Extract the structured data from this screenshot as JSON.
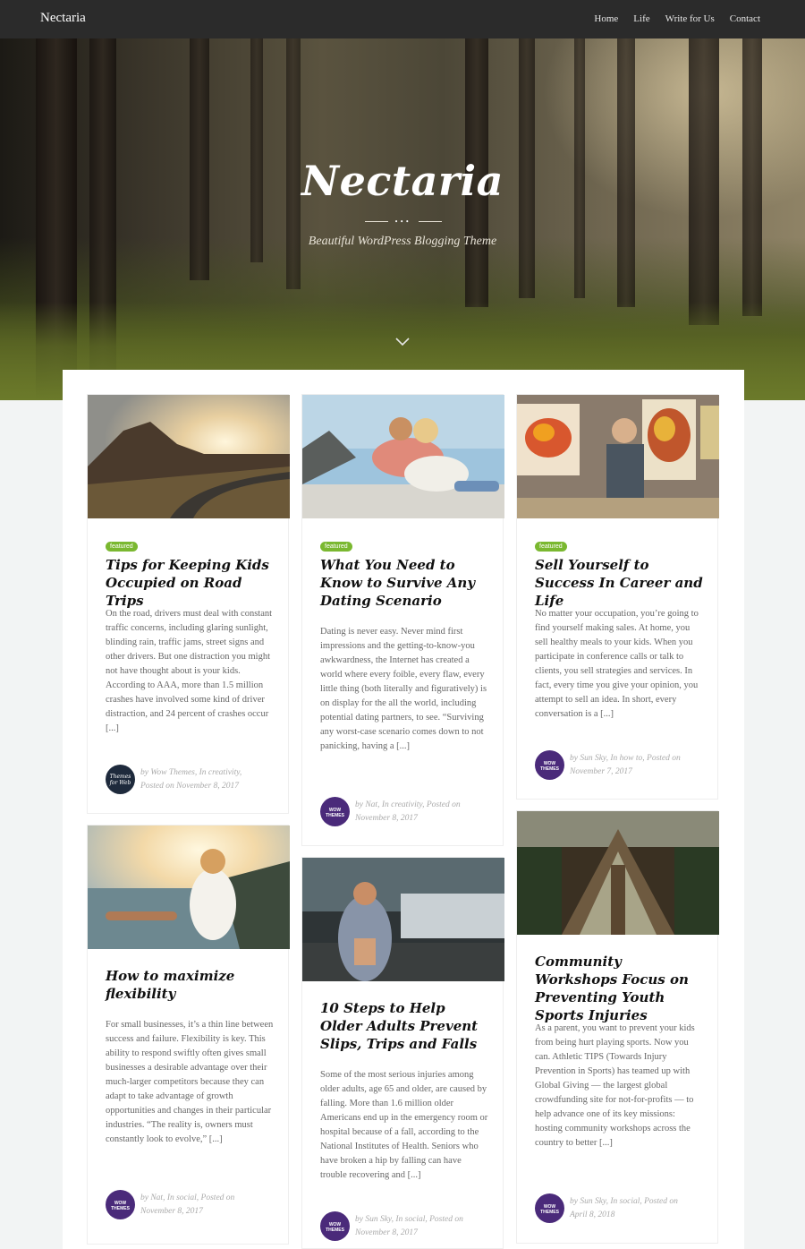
{
  "site": {
    "brand": "Nectaria",
    "nav": [
      "Home",
      "Life",
      "Write for Us",
      "Contact"
    ]
  },
  "hero": {
    "title": "Nectaria",
    "ornament": "•••",
    "subtitle": "Beautiful WordPress Blogging Theme"
  },
  "posts": [
    {
      "badge": "featured",
      "title": "Tips for Keeping Kids Occupied on Road Trips",
      "excerpt": "On the road, drivers must deal with constant traffic concerns, including glaring sunlight, blinding rain, traffic jams, street signs and other drivers. But one distraction you might not have thought about is your kids. According to AAA, more than 1.5 million crashes have involved some kind of driver distraction, and 24 percent of crashes occur [...]",
      "meta_line1": "by Wow Themes, In creativity,",
      "meta_line2": "Posted on November 8, 2017",
      "avatar_text": "Themes for Web"
    },
    {
      "badge": "featured",
      "title": "What You Need to Know to Survive Any Dating Scenario",
      "excerpt": "Dating is never easy. Never mind first impressions and the getting-to-know-you awkwardness, the Internet has created a world where every foible, every flaw, every little thing (both literally and figuratively) is on display for the all the world, including potential dating partners, to see. “Surviving any worst-case scenario comes down to not panicking, having a [...]",
      "meta_line1": "by Nat, In creativity, Posted on",
      "meta_line2": "November 8, 2017",
      "avatar_text": "WOW THEMES"
    },
    {
      "badge": "featured",
      "title": "Sell Yourself to Success In Career and Life",
      "excerpt": "No matter your occupation, you’re going to find yourself making sales. At home, you sell healthy meals to your kids. When you participate in conference calls or talk to clients, you sell strategies and services. In fact, every time you give your opinion, you attempt to sell an idea. In short, every conversation is a [...]",
      "meta_line1": "by Sun Sky, In how to, Posted on",
      "meta_line2": "November 7, 2017",
      "avatar_text": "WOW THEMES"
    },
    {
      "title": "How to maximize flexibility",
      "excerpt": "For small businesses, it’s a thin line between success and failure. Flexibility is key. This ability to respond swiftly often gives small businesses a desirable advantage over their much-larger competitors because they can adapt to take advantage of growth opportunities and changes in their particular industries. “The reality is, owners must constantly look to evolve,” [...]",
      "meta_line1": "by Nat, In social, Posted on",
      "meta_line2": "November 8, 2017",
      "avatar_text": "WOW THEMES"
    },
    {
      "title": "10 Steps to Help Older Adults Prevent Slips, Trips and Falls",
      "excerpt": "Some of the most serious injuries among older adults, age 65 and older, are caused by falling. More than 1.6 million older Americans end up in the emergency room or hospital because of a fall, according to the National Institutes of Health. Seniors who have broken a hip by falling can have trouble recovering and [...]",
      "meta_line1": "by Sun Sky, In social, Posted on",
      "meta_line2": "November 8, 2017",
      "avatar_text": "WOW THEMES"
    },
    {
      "title": "Community Workshops Focus on Preventing Youth Sports Injuries",
      "excerpt": "As a parent, you want to prevent your kids from being hurt playing sports. Now you can. Athletic TIPS (Towards Injury Prevention in Sports) has teamed up with Global Giving — the largest global crowdfunding site for not-for-profits — to help advance one of its key missions: hosting community workshops across the country to better [...]",
      "meta_line1": "by Sun Sky, In social, Posted on",
      "meta_line2": "April 8, 2018",
      "avatar_text": "WOW THEMES"
    }
  ],
  "colors": {
    "topbar": "#2b2b2b",
    "badge": "#7ab830",
    "avatar": "#4a2a7a"
  }
}
